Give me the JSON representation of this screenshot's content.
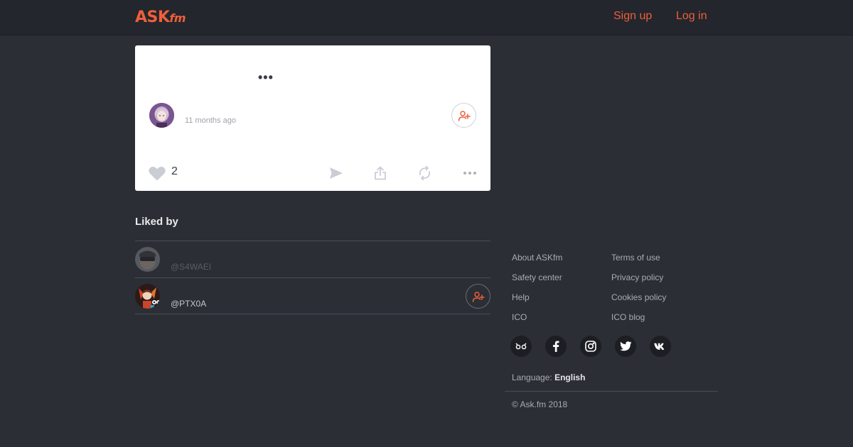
{
  "header": {
    "logo_main": "ASK",
    "logo_suffix": "fm",
    "signup_label": "Sign up",
    "login_label": "Log in"
  },
  "answer_card": {
    "question_text": "•••",
    "time_ago": "11 months ago",
    "like_count": "2"
  },
  "liked_by": {
    "title": "Liked by",
    "users": [
      {
        "username": "@S4WAEI"
      },
      {
        "username": "@PTX0A"
      }
    ]
  },
  "footer": {
    "links_left": [
      "About ASKfm",
      "Safety center",
      "Help",
      "ICO"
    ],
    "links_right": [
      "Terms of use",
      "Privacy policy",
      "Cookies policy",
      "ICO blog"
    ],
    "social": [
      "askfm-icon",
      "facebook-icon",
      "instagram-icon",
      "twitter-icon",
      "vk-icon"
    ],
    "language_label": "Language:",
    "language_value": "English",
    "copyright": "© Ask.fm 2018"
  },
  "colors": {
    "accent": "#ee5f3c",
    "background": "#2b2e35",
    "header": "#23262c",
    "card": "#ffffff"
  }
}
